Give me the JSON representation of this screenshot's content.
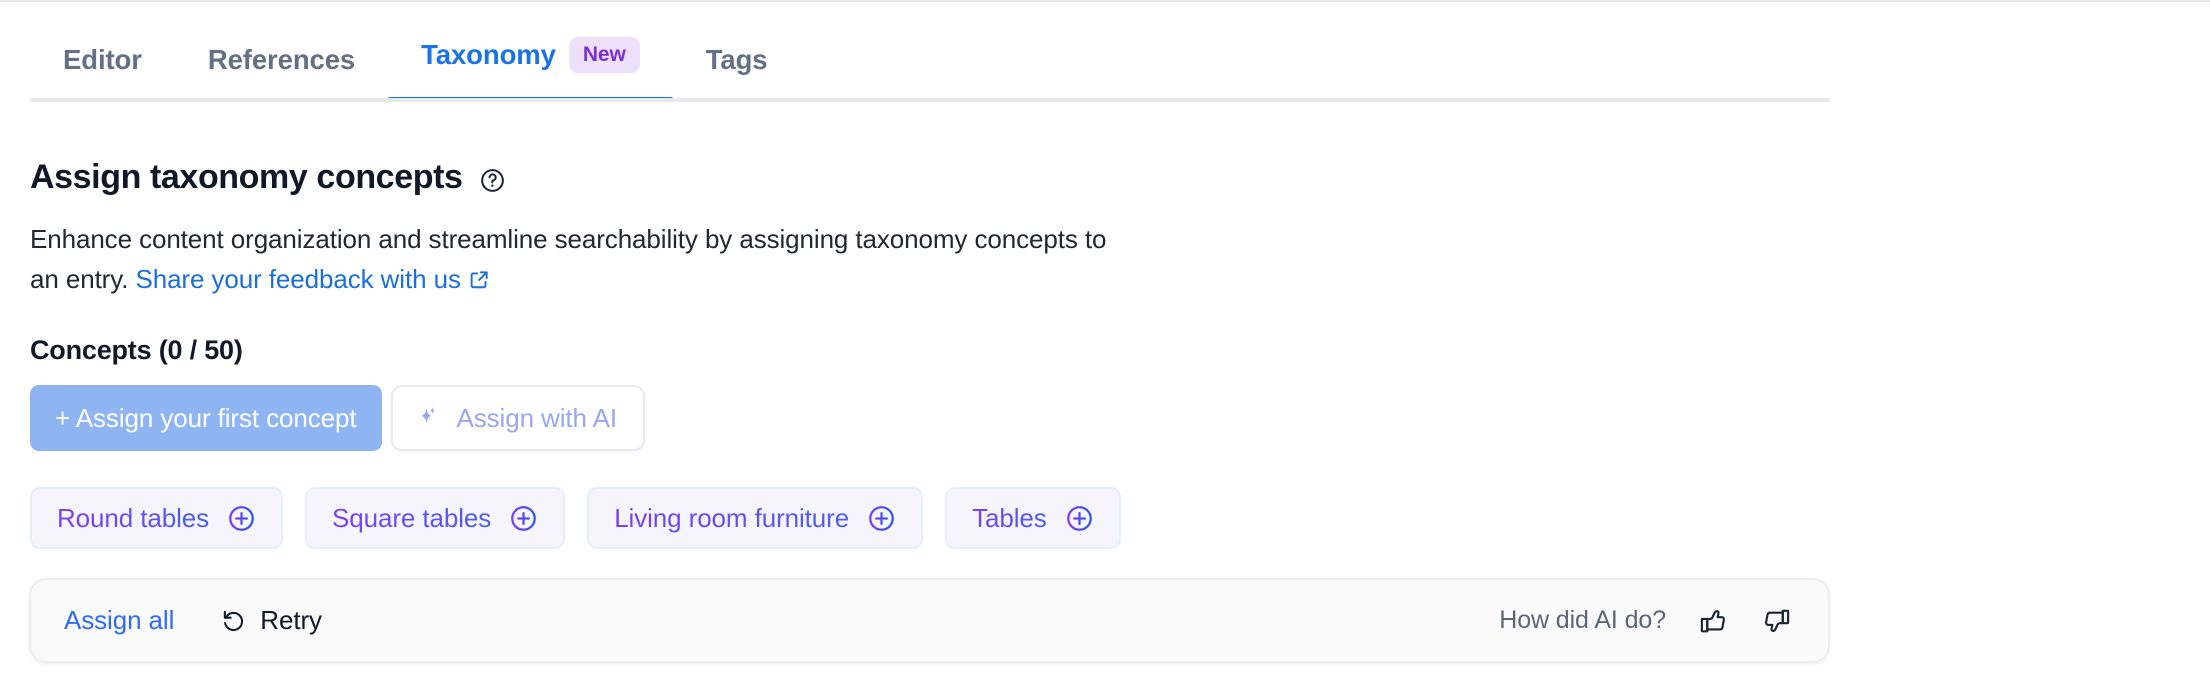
{
  "tabs": [
    {
      "label": "Editor",
      "active": false,
      "badge": null
    },
    {
      "label": "References",
      "active": false,
      "badge": null
    },
    {
      "label": "Taxonomy",
      "active": true,
      "badge": "New"
    },
    {
      "label": "Tags",
      "active": false,
      "badge": null
    }
  ],
  "header": {
    "title": "Assign taxonomy concepts",
    "help_icon": "question-circle-icon",
    "description_before_link": "Enhance content organization and streamline searchability by assigning taxonomy concepts to an entry. ",
    "link_text": "Share your feedback with us",
    "link_icon": "external-link-icon"
  },
  "concepts": {
    "heading": "Concepts (0 / 50)",
    "assigned_count": 0,
    "max_count": 50,
    "primary_button": "+ Assign your first concept",
    "ai_button": "Assign with AI",
    "ai_button_icon": "sparkle-icon",
    "suggestions": [
      {
        "label": "Round tables",
        "icon": "plus-circle-icon"
      },
      {
        "label": "Square tables",
        "icon": "plus-circle-icon"
      },
      {
        "label": "Living room furniture",
        "icon": "plus-circle-icon"
      },
      {
        "label": "Tables",
        "icon": "plus-circle-icon"
      }
    ]
  },
  "ai_bar": {
    "assign_all": "Assign all",
    "retry": "Retry",
    "retry_icon": "rotate-ccw-icon",
    "feedback_prompt": "How did AI do?",
    "thumbs_up_icon": "thumbs-up-icon",
    "thumbs_down_icon": "thumbs-down-icon"
  },
  "colors": {
    "accent_blue": "#1a73e8",
    "link_blue": "#1a6fdc",
    "badge_bg": "#eee0fb",
    "badge_text": "#7b2fd4",
    "primary_button_bg": "#8fb4f2",
    "ai_purple": "#9aa7ef",
    "chip_gradient_start": "#7b3ff2",
    "chip_gradient_end": "#4a5ef0"
  }
}
